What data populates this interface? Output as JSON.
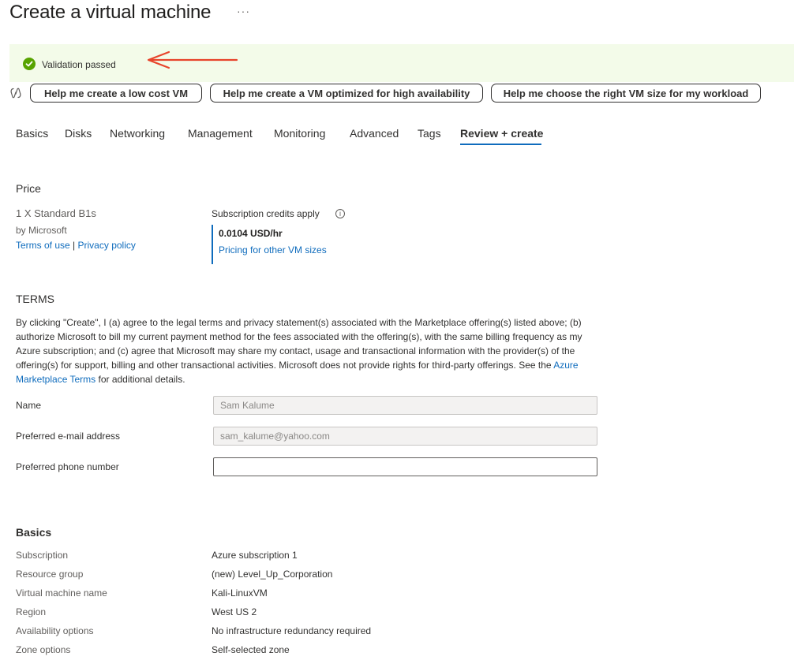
{
  "page": {
    "title": "Create a virtual machine",
    "more": "···"
  },
  "banner": {
    "text": "Validation passed",
    "colors": {
      "background": "#f3fbe9",
      "check": "#57a300",
      "annotation_arrow": "#e8442b"
    },
    "icons": {
      "status": "check-circle-icon",
      "annotation": "red-arrow-icon"
    }
  },
  "copilot": {
    "icon": "copilot-icon",
    "buttons": [
      "Help me create a low cost VM",
      "Help me create a VM optimized for high availability",
      "Help me choose the right VM size for my workload"
    ]
  },
  "tabs": {
    "items": [
      "Basics",
      "Disks",
      "Networking",
      "Management",
      "Monitoring",
      "Advanced",
      "Tags",
      "Review + create"
    ],
    "active": "Review + create",
    "accent": "#0f6cbd"
  },
  "price": {
    "heading": "Price",
    "product": "1 X Standard B1s",
    "publisher": "by Microsoft",
    "terms_link": "Terms of use",
    "separator": "|",
    "privacy_link": "Privacy policy",
    "credits_label": "Subscription credits apply",
    "info_icon": "info-icon",
    "amount": "0.0104 USD/hr",
    "pricing_link": "Pricing for other VM sizes"
  },
  "terms": {
    "heading": "TERMS",
    "body_before": "By clicking \"Create\", I (a) agree to the legal terms and privacy statement(s) associated with the Marketplace offering(s) listed above; (b) authorize Microsoft to bill my current payment method for the fees associated with the offering(s), with the same billing frequency as my Azure subscription; and (c) agree that Microsoft may share my contact, usage and transactional information with the provider(s) of the offering(s) for support, billing and other transactional activities. Microsoft does not provide rights for third-party offerings. See the ",
    "link": "Azure Marketplace Terms",
    "body_after": " for additional details."
  },
  "contact": {
    "name_label": "Name",
    "name_value": "Sam Kalume",
    "email_label": "Preferred e-mail address",
    "email_value": "sam_kalume@yahoo.com",
    "phone_label": "Preferred phone number",
    "phone_value": ""
  },
  "basics": {
    "heading": "Basics",
    "rows": [
      {
        "label": "Subscription",
        "value": "Azure subscription 1"
      },
      {
        "label": "Resource group",
        "value": "(new) Level_Up_Corporation"
      },
      {
        "label": "Virtual machine name",
        "value": "Kali-LinuxVM"
      },
      {
        "label": "Region",
        "value": "West US 2"
      },
      {
        "label": "Availability options",
        "value": "No infrastructure redundancy required"
      },
      {
        "label": "Zone options",
        "value": "Self-selected zone"
      }
    ]
  }
}
